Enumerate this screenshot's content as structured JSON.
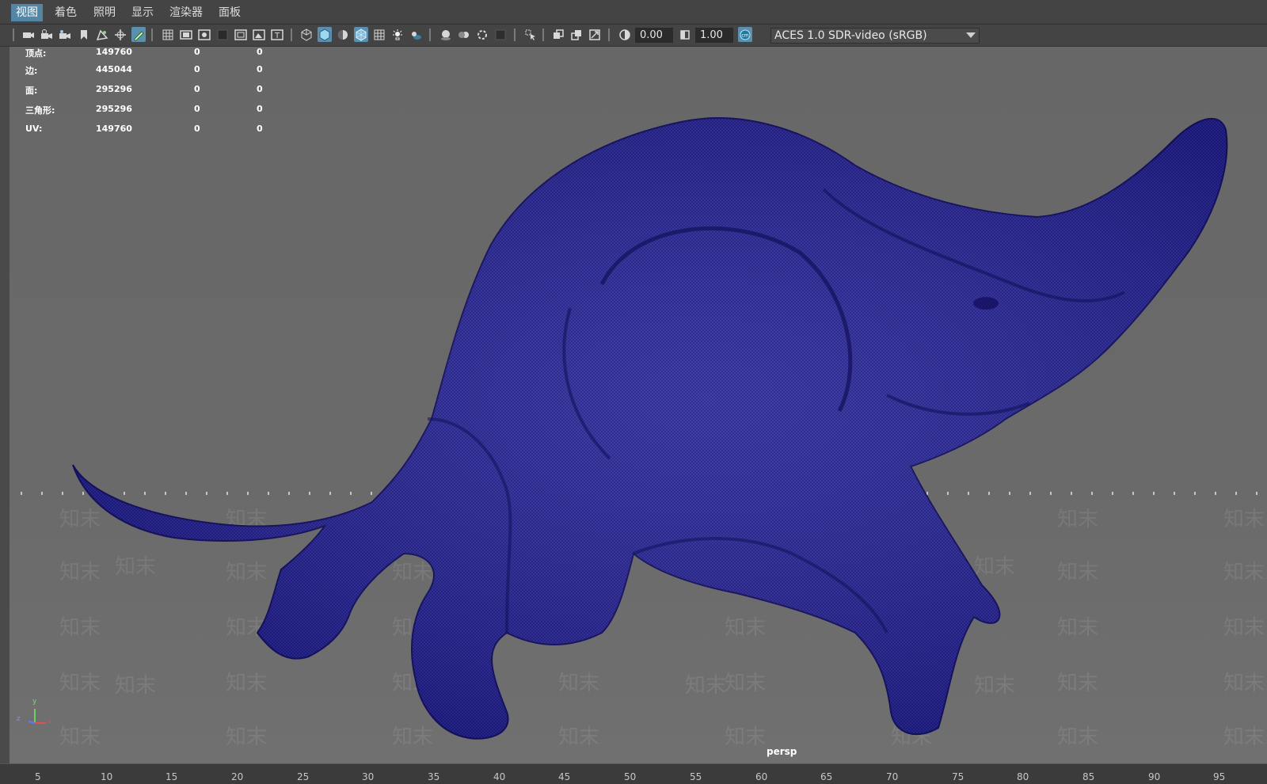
{
  "menu": {
    "items": [
      {
        "label": "视图",
        "active": true
      },
      {
        "label": "着色",
        "active": false
      },
      {
        "label": "照明",
        "active": false
      },
      {
        "label": "显示",
        "active": false
      },
      {
        "label": "渲染器",
        "active": false
      },
      {
        "label": "面板",
        "active": false
      }
    ]
  },
  "toolbar": {
    "exposure_value": "0.00",
    "gamma_value": "1.00",
    "color_space": "ACES 1.0 SDR-video (sRGB)"
  },
  "hud_stats": {
    "rows": [
      {
        "label": "顶点:",
        "values": [
          "149760",
          "0",
          "0"
        ]
      },
      {
        "label": "边:",
        "values": [
          "445044",
          "0",
          "0"
        ]
      },
      {
        "label": "面:",
        "values": [
          "295296",
          "0",
          "0"
        ]
      },
      {
        "label": "三角形:",
        "values": [
          "295296",
          "0",
          "0"
        ]
      },
      {
        "label": "UV:",
        "values": [
          "149760",
          "0",
          "0"
        ]
      }
    ]
  },
  "viewport": {
    "camera_label": "persp",
    "watermark_text": "知末",
    "mesh_color": "#1d1a8a",
    "background_color": "#6a6a6a"
  },
  "axis_gizmo": {
    "x": "x",
    "y": "y",
    "z": "z"
  },
  "timeline": {
    "ticks": [
      "5",
      "10",
      "15",
      "20",
      "25",
      "30",
      "35",
      "40",
      "45",
      "50",
      "55",
      "60",
      "65",
      "70",
      "75",
      "80",
      "85",
      "90",
      "95"
    ]
  },
  "colors": {
    "accent": "#5285a6",
    "panel": "#444444"
  }
}
